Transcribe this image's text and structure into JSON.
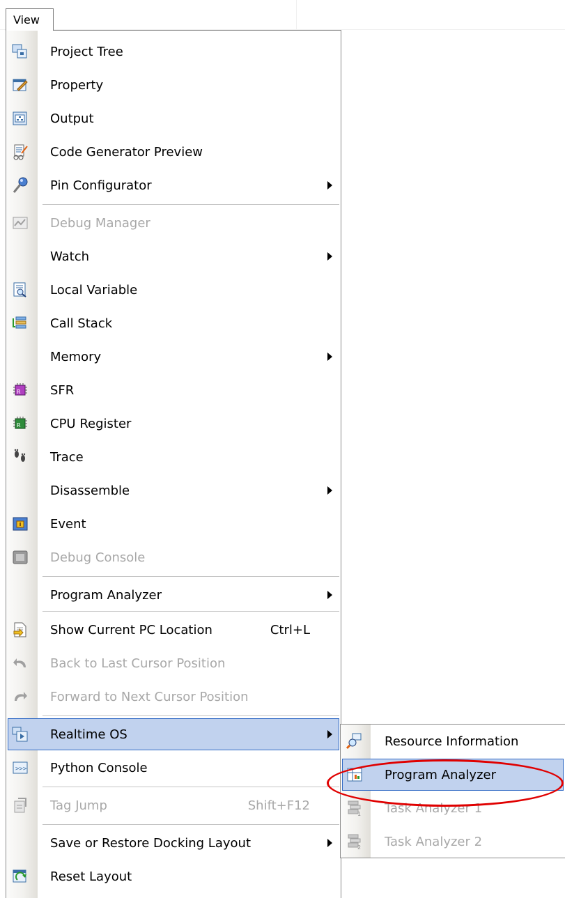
{
  "menubar": {
    "view_label": "View"
  },
  "main_menu": {
    "items": [
      {
        "label": "Project Tree",
        "icon": "project-tree-icon"
      },
      {
        "label": "Property",
        "icon": "property-icon"
      },
      {
        "label": "Output",
        "icon": "output-icon"
      },
      {
        "label": "Code Generator Preview",
        "icon": "code-generator-icon"
      },
      {
        "label": "Pin Configurator",
        "icon": "pin-configurator-icon",
        "submenu": true
      },
      {
        "label": "Debug Manager",
        "icon": "debug-manager-icon",
        "disabled": true
      },
      {
        "label": "Watch",
        "submenu": true
      },
      {
        "label": "Local Variable",
        "icon": "local-variable-icon"
      },
      {
        "label": "Call Stack",
        "icon": "call-stack-icon"
      },
      {
        "label": "Memory",
        "submenu": true
      },
      {
        "label": "SFR",
        "icon": "sfr-chip-icon"
      },
      {
        "label": "CPU Register",
        "icon": "cpu-register-chip-icon"
      },
      {
        "label": "Trace",
        "icon": "trace-footprints-icon"
      },
      {
        "label": "Disassemble",
        "submenu": true
      },
      {
        "label": "Event",
        "icon": "event-icon"
      },
      {
        "label": "Debug Console",
        "icon": "debug-console-icon",
        "disabled": true
      },
      {
        "label": "Program Analyzer",
        "submenu": true
      },
      {
        "label": "Show Current PC Location",
        "shortcut": "Ctrl+L",
        "icon": "pc-location-icon"
      },
      {
        "label": "Back to Last Cursor Position",
        "icon": "back-arrow-icon",
        "disabled": true
      },
      {
        "label": "Forward to Next Cursor Position",
        "icon": "forward-arrow-icon",
        "disabled": true
      },
      {
        "label": "Realtime OS",
        "icon": "realtime-os-icon",
        "submenu": true,
        "selected": true
      },
      {
        "label": "Python Console",
        "icon": "python-console-icon"
      },
      {
        "label": "Tag Jump",
        "shortcut": "Shift+F12",
        "icon": "tag-jump-icon",
        "disabled": true
      },
      {
        "label": "Save or Restore Docking Layout",
        "submenu": true
      },
      {
        "label": "Reset Layout",
        "icon": "reset-layout-icon"
      }
    ]
  },
  "sub_menu": {
    "items": [
      {
        "label": "Resource Information",
        "icon": "resource-information-icon"
      },
      {
        "label": "Program Analyzer",
        "icon": "program-analyzer-icon",
        "selected": true
      },
      {
        "label": "Task Analyzer 1",
        "icon": "task-analyzer-1-icon",
        "disabled": true
      },
      {
        "label": "Task Analyzer 2",
        "icon": "task-analyzer-2-icon",
        "disabled": true
      }
    ]
  },
  "colors": {
    "highlight": "#c1d2ee",
    "highlight_border": "#316ac5",
    "annotation": "#e00000",
    "disabled_text": "#a8a8a8"
  }
}
